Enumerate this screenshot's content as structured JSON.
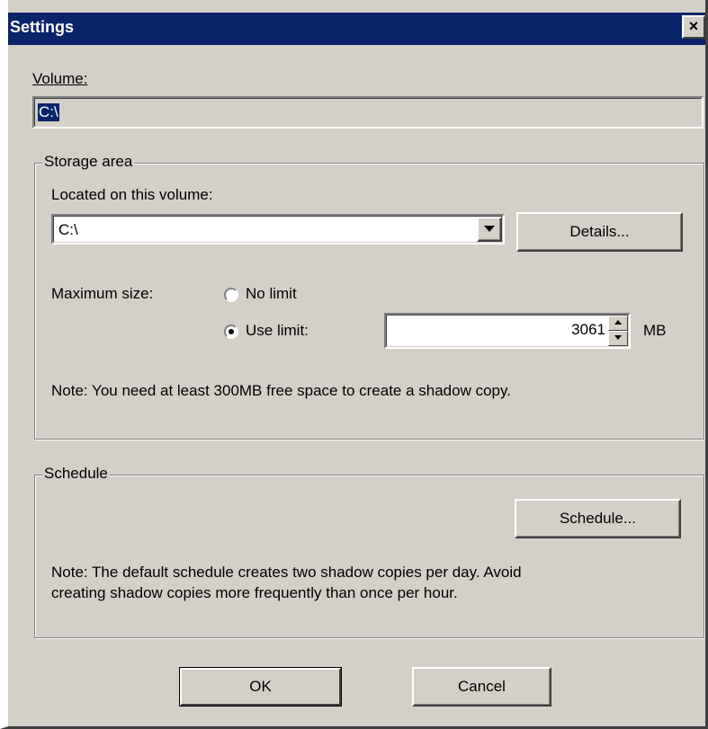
{
  "window": {
    "title": "Settings",
    "close_glyph": "×"
  },
  "volume": {
    "label": "Volume:",
    "value": "C:\\"
  },
  "storage": {
    "group_title": "Storage area",
    "located_label": "Located on this volume:",
    "located_value": "C:\\",
    "details_button": "Details...",
    "max_size_label": "Maximum size:",
    "no_limit_label": "No limit",
    "use_limit_label": "Use limit:",
    "selected_option": "use_limit",
    "limit_value": "3061",
    "unit": "MB",
    "note": "Note: You need at least 300MB free space to create a shadow copy."
  },
  "schedule": {
    "group_title": "Schedule",
    "button": "Schedule...",
    "note_line1": "Note: The default schedule creates two shadow copies per day. Avoid",
    "note_line2": "creating shadow copies more frequently than once per hour."
  },
  "footer": {
    "ok_button": "OK",
    "cancel_button": "Cancel"
  },
  "icons": {
    "dropdown_arrow": "chevron-down-icon",
    "spin_up": "arrow-up-icon",
    "spin_down": "arrow-down-icon",
    "close": "close-icon"
  },
  "colors": {
    "titlebar": "#0a246a",
    "face": "#d4d0c8",
    "selection": "#0a246a"
  }
}
